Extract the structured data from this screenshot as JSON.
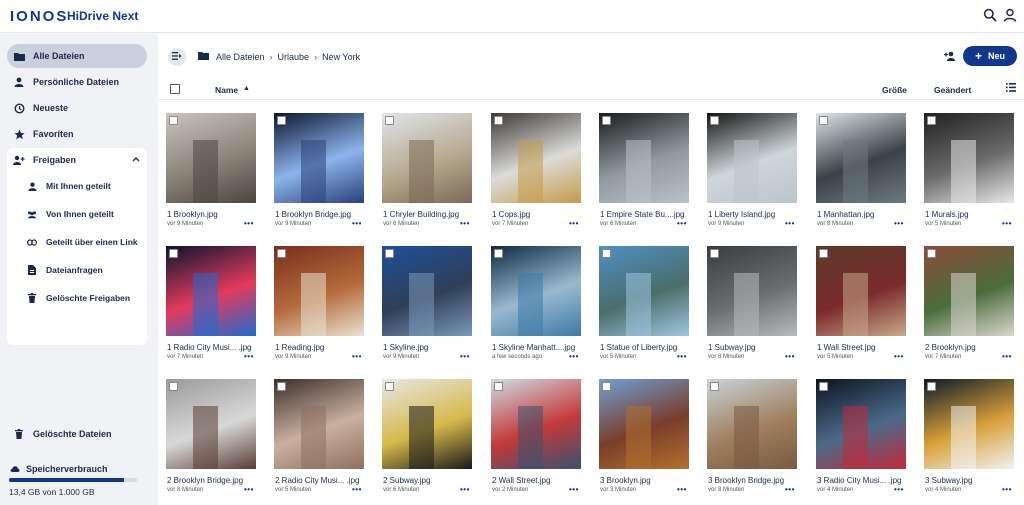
{
  "header": {
    "logo": "IONOS",
    "product": "HiDrive Next"
  },
  "sidebar": {
    "items": [
      {
        "label": "Alle Dateien",
        "icon": "folder-icon"
      },
      {
        "label": "Persönliche Dateien",
        "icon": "person-icon"
      },
      {
        "label": "Neueste",
        "icon": "history-icon"
      },
      {
        "label": "Favoriten",
        "icon": "star-icon"
      },
      {
        "label": "Freigaben",
        "icon": "share-people-icon"
      }
    ],
    "share_items": [
      {
        "label": "Mit Ihnen geteilt",
        "icon": "person-icon"
      },
      {
        "label": "Von Ihnen geteilt",
        "icon": "group-icon"
      },
      {
        "label": "Geteilt über einen Link",
        "icon": "link-icon"
      },
      {
        "label": "Dateianfragen",
        "icon": "file-request-icon"
      },
      {
        "label": "Gelöschte Freigaben",
        "icon": "trash-icon"
      }
    ],
    "deleted_files": "Gelöschte Dateien",
    "storage_title": "Speicherverbrauch",
    "storage_text": "13,4 GB von 1.000 GB",
    "storage_fraction": 0.9
  },
  "breadcrumb": [
    "Alle Dateien",
    "Urlaube",
    "New York"
  ],
  "new_button": "Neu",
  "columns": {
    "name": "Name",
    "size": "Größe",
    "modified": "Geändert"
  },
  "files": [
    {
      "name": "1 Brooklyn.jpg",
      "time": "vor 9 Minuten",
      "c": [
        "#c9c4bc",
        "#4a4640",
        "#8a8378"
      ]
    },
    {
      "name": "1 Brooklyn Bridge.jpg",
      "time": "vor 9 Minuten",
      "c": [
        "#0d1631",
        "#2b3f79",
        "#8cb4ec"
      ]
    },
    {
      "name": "1 Chryler Building.jpg",
      "time": "vor 6 Minuten",
      "c": [
        "#dfe5ea",
        "#7a6a55",
        "#b8aa90"
      ]
    },
    {
      "name": "1 Cops.jpg",
      "time": "vor 7 Minuten",
      "c": [
        "#3d3a36",
        "#c59a4a",
        "#dcdcd8"
      ]
    },
    {
      "name": "1 Empire State Bu....jpg",
      "time": "vor 6 Minuten",
      "c": [
        "#1b1b1b",
        "#b8c3c9",
        "#8f9aa0"
      ]
    },
    {
      "name": "1 Liberty Island.jpg",
      "time": "vor 9 Minuten",
      "c": [
        "#151515",
        "#b9c5cb",
        "#cfd6da"
      ]
    },
    {
      "name": "1 Manhattan.jpg",
      "time": "vor 8 Minuten",
      "c": [
        "#dde3e6",
        "#6d7a82",
        "#3a4248"
      ]
    },
    {
      "name": "1 Murals.jpg",
      "time": "vor 5 Minuten",
      "c": [
        "#202020",
        "#e8e8e8",
        "#6b6b6b"
      ]
    },
    {
      "name": "1 Radio City Musi... .jpg",
      "time": "vor 7 Minuten",
      "c": [
        "#0b1430",
        "#1f6bd1",
        "#e33a5c"
      ]
    },
    {
      "name": "1 Reading.jpg",
      "time": "vor 9 Minuten",
      "c": [
        "#7a2d1c",
        "#e9e2d2",
        "#b56b3c"
      ]
    },
    {
      "name": "1 Skyline.jpg",
      "time": "vor 9 Minuten",
      "c": [
        "#1e4f9a",
        "#7a98bb",
        "#2f3f57"
      ]
    },
    {
      "name": "1 Skyline Manhatt....jpg",
      "time": "a few seconds ago",
      "c": [
        "#0e2a44",
        "#3d7aa6",
        "#9ab9cf"
      ]
    },
    {
      "name": "1 Statue of Liberty.jpg",
      "time": "vor 5 Minuten",
      "c": [
        "#4f8fc4",
        "#9fc5e0",
        "#4a6e6a"
      ]
    },
    {
      "name": "1 Subway.jpg",
      "time": "vor 8 Minuten",
      "c": [
        "#3a3d40",
        "#b7bbbe",
        "#6a6d70"
      ]
    },
    {
      "name": "1 Wall Street.jpg",
      "time": "vor 5 Minuten",
      "c": [
        "#5a3b2a",
        "#c9a88a",
        "#7a2b2b"
      ]
    },
    {
      "name": "2 Brooklyn.jpg",
      "time": "vor 7 Minuten",
      "c": [
        "#8a4a3a",
        "#dbd7cf",
        "#4b6d3c"
      ]
    },
    {
      "name": "2 Brooklyn Bridge.jpg",
      "time": "vor 8 Minuten",
      "c": [
        "#9a9a9a",
        "#5a3d33",
        "#d8d8d8"
      ]
    },
    {
      "name": "2 Radio City Musi... .jpg",
      "time": "vor 5 Minuten",
      "c": [
        "#3d2f2a",
        "#8e7060",
        "#c9b0a0"
      ]
    },
    {
      "name": "2 Subway.jpg",
      "time": "vor 6 Minuten",
      "c": [
        "#e7e7e7",
        "#1a1a1a",
        "#d6b94a"
      ]
    },
    {
      "name": "2 Wall Street.jpg",
      "time": "vor 2 Minuten",
      "c": [
        "#cfdbe3",
        "#3a5070",
        "#c43a3a"
      ]
    },
    {
      "name": "3 Brooklyn.jpg",
      "time": "vor 3 Minuten",
      "c": [
        "#6ea0d6",
        "#b2702f",
        "#7a3d2a"
      ]
    },
    {
      "name": "3 Brooklyn Bridge.jpg",
      "time": "vor 8 Minuten",
      "c": [
        "#c9d3d8",
        "#7a5a40",
        "#a08060"
      ]
    },
    {
      "name": "3 Radio City Musi... .jpg",
      "time": "vor 4 Minuten",
      "c": [
        "#0c1420",
        "#c12a3a",
        "#4a6a8a"
      ]
    },
    {
      "name": "3 Subway.jpg",
      "time": "vor 4 Minuten",
      "c": [
        "#0e1a2a",
        "#f2f2f2",
        "#d8a03a"
      ]
    }
  ]
}
